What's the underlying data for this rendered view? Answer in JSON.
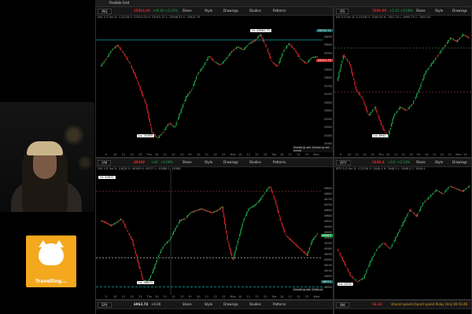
{
  "window": {
    "title": "Flexible Grid"
  },
  "toolbar_labels": {
    "share": "Share",
    "style": "Style",
    "drawings": "Drawings",
    "studies": "Studies",
    "patterns": "Patterns"
  },
  "stream": {
    "overlay_label": "Travelling..."
  },
  "colors": {
    "up": "#1fa84a",
    "down": "#d9262b",
    "accent_cyan": "#14c7c7",
    "background": "#000000"
  },
  "panels": [
    {
      "id": "nq",
      "symbol": "/NQ",
      "last": "25914.00",
      "change": "+94.00",
      "change_pct": "+0.33%",
      "ohlc": "/NQ 5 D 5m  D: 1/13/26  O: 25914.00  H: 25915.75  L: 25908.25  C: 25914.75",
      "high_label": "Hi: 26062.75",
      "low_label": "Lo: 25369",
      "price_tag": "25911.75",
      "level_tag": "26055.52",
      "notice": "Drawing set: Drawing set name",
      "yticks": [
        "26050",
        "26000",
        "25950",
        "25900",
        "25850",
        "25800",
        "25750",
        "25700",
        "25650",
        "25600",
        "25550",
        "25500",
        "25450",
        "25400"
      ],
      "xticks": [
        "9",
        "10",
        "11",
        "12",
        "13",
        "Thu",
        "10",
        "11",
        "12",
        "13",
        "Fri",
        "10",
        "11",
        "12",
        "13",
        "Mon",
        "10",
        "11",
        "12",
        "13",
        "Tue",
        "10",
        "11",
        "12",
        "13",
        "Mon"
      ],
      "chart_data": {
        "type": "candlestick",
        "series": [
          {
            "values": [
              25850,
              25900,
              25960,
              25990,
              25940,
              25880,
              25800,
              25700,
              25600,
              25420,
              25380,
              25420,
              25480,
              25450,
              25550,
              25650,
              25700,
              25800,
              25850,
              25920,
              25880,
              25860,
              25900,
              25950,
              25980,
              25960,
              26000,
              26020,
              26060,
              25980,
              25880,
              25850,
              25950,
              26000,
              25960,
              25900,
              25870,
              25910,
              25914
            ]
          }
        ]
      }
    },
    {
      "id": "es",
      "symbol": "/ES",
      "last": "7000.00",
      "change": "+5.25",
      "change_pct": "+0.08%",
      "ohlc": "/ES 5 D 5m  D: 1/13/26  O: 7000.00  H: 7001.25  L: 6999.75  C: 7000.00",
      "low_label": "Lo: 6940",
      "xticks": [
        "9",
        "10",
        "11",
        "12",
        "13",
        "Thu",
        "10",
        "11",
        "12",
        "13",
        "Fri",
        "10",
        "11",
        "12",
        "13",
        "Mon",
        "10"
      ],
      "chart_data": {
        "type": "candlestick",
        "series": [
          {
            "values": [
              6975,
              6990,
              6985,
              6970,
              6965,
              6955,
              6960,
              6950,
              6942,
              6955,
              6960,
              6958,
              6962,
              6970,
              6980,
              6985,
              6990,
              6995,
              7000,
              6998,
              7002,
              7000
            ]
          }
        ]
      }
    },
    {
      "id": "ym",
      "symbol": "/YM",
      "last": "49369",
      "change": "+44",
      "change_pct": "+0.09%",
      "ohlc": "/YM 5 D 5m  D: 1/8/26  O: 49369  H: 49371  L: 49366  C: 49368",
      "high_label": "Hi: 49870",
      "low_label": "Lo: 48853",
      "price_tag": "49367",
      "level_tag": "48953",
      "notice": "Drawing set: Default",
      "yticks": [
        "49850",
        "49800",
        "49750",
        "49700",
        "49650",
        "49600",
        "49550",
        "49500",
        "49450",
        "49400",
        "49350",
        "49300",
        "49250",
        "49200",
        "49150",
        "49100",
        "49050",
        "49000",
        "48950"
      ],
      "xticks": [
        "9",
        "10",
        "11",
        "12",
        "13",
        "Thu",
        "10",
        "11",
        "12",
        "13",
        "Fri",
        "10",
        "11",
        "12",
        "13",
        "Mon",
        "10",
        "11",
        "12",
        "13",
        "Tue",
        "10",
        "11",
        "12",
        "13",
        "Wed"
      ],
      "chart_data": {
        "type": "candlestick",
        "series": [
          {
            "values": [
              49500,
              49480,
              49450,
              49480,
              49520,
              49400,
              49300,
              49100,
              48900,
              48880,
              49000,
              49150,
              49250,
              49300,
              49400,
              49500,
              49520,
              49580,
              49600,
              49620,
              49600,
              49580,
              49600,
              49640,
              49300,
              49100,
              49300,
              49500,
              49620,
              49650,
              49700,
              49780,
              49850,
              49700,
              49500,
              49350,
              49300,
              49250,
              49200,
              49150,
              49300,
              49369
            ]
          }
        ]
      }
    },
    {
      "id": "rty",
      "symbol": "/RTY",
      "last": "2648.4",
      "change": "+3.6",
      "change_pct": "+0.14%",
      "ohlc": "/RTY 5 D 5m  D: 1/13/26  O: 2648.4  H: 2648.5  L: 2648.0  C: 2648.4",
      "low_label": "Lo: 2574",
      "chart_data": {
        "type": "candlestick",
        "series": [
          {
            "values": [
              2600,
              2590,
              2580,
              2575,
              2578,
              2590,
              2600,
              2605,
              2600,
              2610,
              2620,
              2630,
              2625,
              2635,
              2640,
              2645,
              2642,
              2648,
              2646,
              2644,
              2648
            ]
          }
        ]
      }
    },
    {
      "id": "spx",
      "symbol": "SPX",
      "last": "6963.74",
      "change": "+0.00"
    },
    {
      "id": "nk",
      "symbol": "/NK",
      "last": "16.63",
      "notice": "shared speed shared speed Relay Only 00:03:46"
    }
  ]
}
